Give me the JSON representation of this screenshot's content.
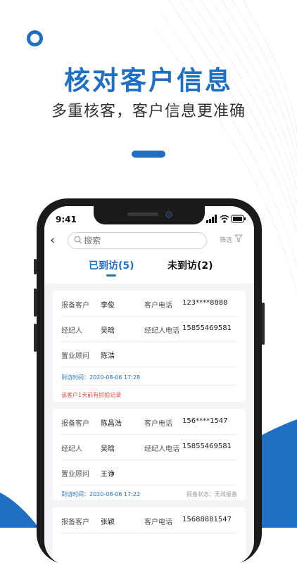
{
  "banner": {
    "title": "核对客户信息",
    "subtitle": "多重核客，客户信息更准确"
  },
  "colors": {
    "accent": "#1f6fc5",
    "warning": "#e04848"
  },
  "phone": {
    "status_time": "9:41",
    "search_placeholder": "搜索",
    "filter_label": "筛选",
    "tabs": [
      {
        "label": "已到访(5)",
        "active": true
      },
      {
        "label": "未到访(2)",
        "active": false
      }
    ],
    "records": [
      {
        "customer_label": "报备客户",
        "customer": "李俊",
        "phone_label": "客户电话",
        "phone": "123****8888",
        "agent_label": "经纪人",
        "agent": "吴晗",
        "agent_phone_label": "经纪人电话",
        "agent_phone": "15855469581",
        "consultant_label": "置业顾问",
        "consultant": "陈浩",
        "visit_time": "到访时间：2020-08-06 17:28",
        "note": "该客户1天前有抓拍记录"
      },
      {
        "customer_label": "报备客户",
        "customer": "陈昌浩",
        "phone_label": "客户电话",
        "phone": "156****1547",
        "agent_label": "经纪人",
        "agent": "吴晗",
        "agent_phone_label": "经纪人电话",
        "agent_phone": "15855469581",
        "consultant_label": "置业顾问",
        "consultant": "王诤",
        "visit_time": "到访时间：2020-08-06 17:22",
        "status": "报备状态：无效报备"
      },
      {
        "customer_label": "报备客户",
        "customer": "张颖",
        "phone_label": "客户电话",
        "phone": "15688881547"
      }
    ]
  }
}
